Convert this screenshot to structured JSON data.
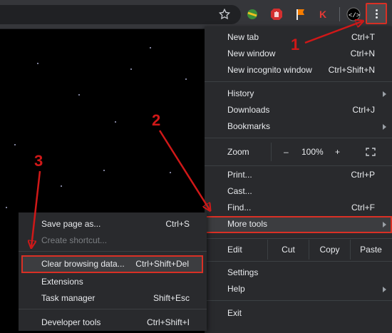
{
  "menu": {
    "new_tab": {
      "label": "New tab",
      "shortcut": "Ctrl+T"
    },
    "new_window": {
      "label": "New window",
      "shortcut": "Ctrl+N"
    },
    "new_incognito": {
      "label": "New incognito window",
      "shortcut": "Ctrl+Shift+N"
    },
    "history": {
      "label": "History"
    },
    "downloads": {
      "label": "Downloads",
      "shortcut": "Ctrl+J"
    },
    "bookmarks": {
      "label": "Bookmarks"
    },
    "zoom": {
      "label": "Zoom",
      "minus": "–",
      "level": "100%",
      "plus": "+"
    },
    "print": {
      "label": "Print...",
      "shortcut": "Ctrl+P"
    },
    "cast": {
      "label": "Cast..."
    },
    "find": {
      "label": "Find...",
      "shortcut": "Ctrl+F"
    },
    "more_tools": {
      "label": "More tools"
    },
    "edit": {
      "label": "Edit",
      "cut": "Cut",
      "copy": "Copy",
      "paste": "Paste"
    },
    "settings": {
      "label": "Settings"
    },
    "help": {
      "label": "Help"
    },
    "exit": {
      "label": "Exit"
    }
  },
  "submenu": {
    "save_page": {
      "label": "Save page as...",
      "shortcut": "Ctrl+S"
    },
    "create_shortcut": {
      "label": "Create shortcut..."
    },
    "clear_browsing": {
      "label": "Clear browsing data...",
      "shortcut": "Ctrl+Shift+Del"
    },
    "extensions": {
      "label": "Extensions"
    },
    "task_manager": {
      "label": "Task manager",
      "shortcut": "Shift+Esc"
    },
    "developer_tools": {
      "label": "Developer tools",
      "shortcut": "Ctrl+Shift+I"
    }
  },
  "annotations": {
    "one": "1",
    "two": "2",
    "three": "3"
  },
  "icons": {
    "star": "bookmark-star-icon",
    "kebab": "chrome-menu-icon"
  },
  "colors": {
    "annotation_red": "#d01818",
    "menu_bg": "#292a2d",
    "toolbar_bg": "#35363a"
  }
}
